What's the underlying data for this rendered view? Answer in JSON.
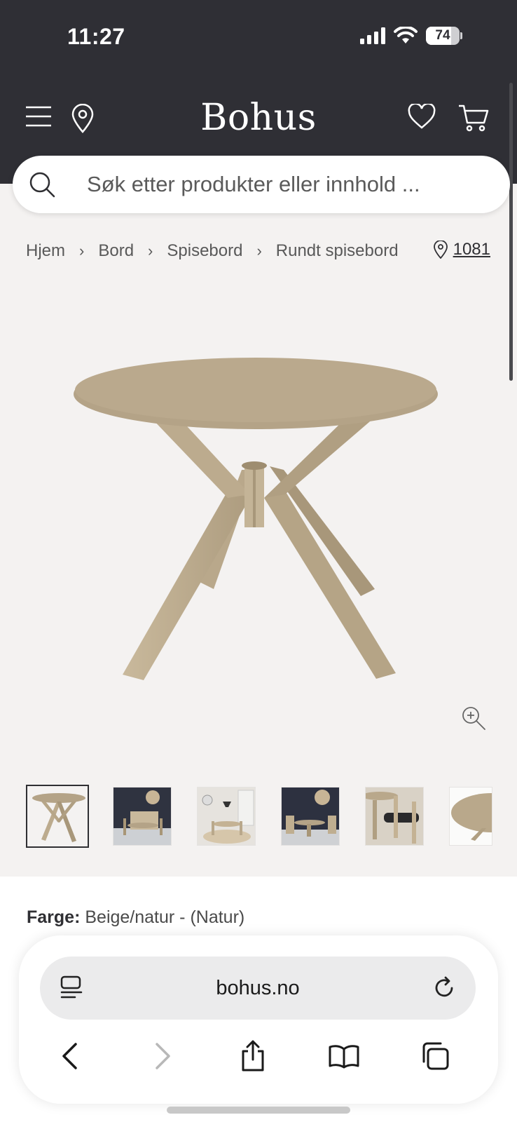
{
  "status_bar": {
    "time": "11:27",
    "battery": "74",
    "battery_level": 0.74
  },
  "header": {
    "brand": "Bohus",
    "icons": [
      "menu-icon",
      "location-pin-icon",
      "heart-icon",
      "cart-icon"
    ]
  },
  "search": {
    "placeholder": "Søk etter produkter eller innhold ..."
  },
  "breadcrumb": {
    "items": [
      "Hjem",
      "Bord",
      "Spisebord",
      "Rundt spisebord"
    ],
    "store_number": "1081"
  },
  "product": {
    "thumbnails": [
      "table-front",
      "dining-room-dark",
      "dining-room-light",
      "dining-set-dark",
      "chairs-detail",
      "tabletop-detail"
    ],
    "selected_thumbnail": 0,
    "color_label": "Farge:",
    "color_value": "Beige/natur - (Natur)"
  },
  "browser": {
    "url": "bohus.no"
  },
  "colors": {
    "header_bg": "#2f2f35",
    "page_bg": "#f4f2f1",
    "wood": "#b8a88e"
  }
}
